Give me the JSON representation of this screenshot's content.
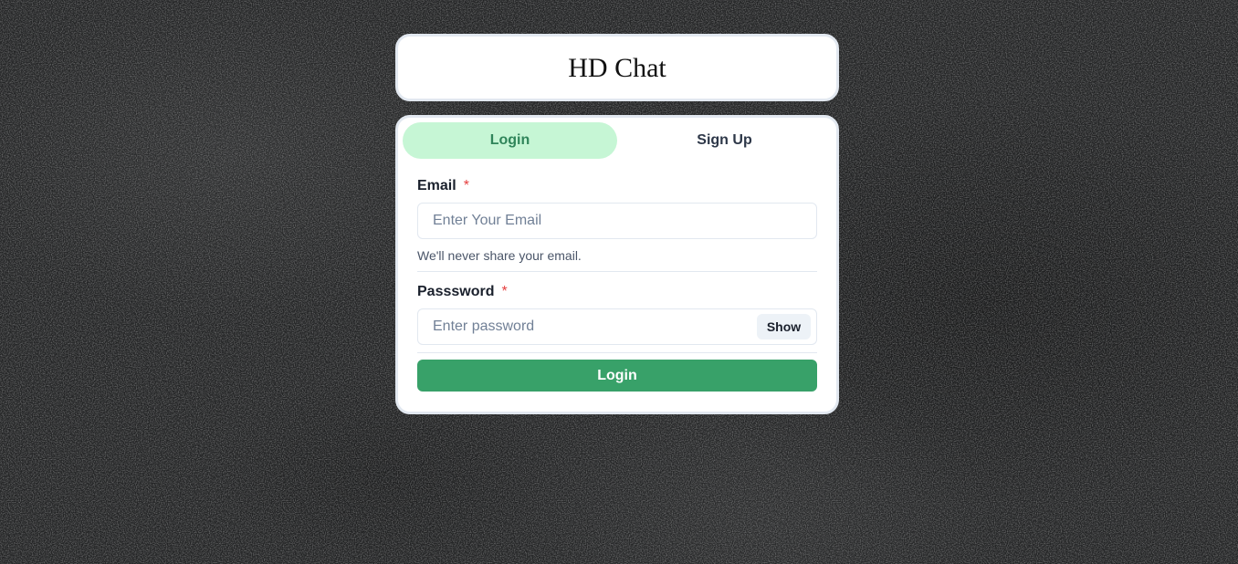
{
  "app": {
    "title": "HD Chat"
  },
  "tabs": [
    {
      "label": "Login",
      "active": true
    },
    {
      "label": "Sign Up",
      "active": false
    }
  ],
  "form": {
    "email": {
      "label": "Email",
      "required_mark": "*",
      "placeholder": "Enter Your Email",
      "value": "",
      "helper": "We'll never share your email."
    },
    "password": {
      "label": "Passsword",
      "required_mark": "*",
      "placeholder": "Enter password",
      "value": "",
      "toggle_label": "Show"
    },
    "submit_label": "Login"
  },
  "colors": {
    "active_tab_bg": "#c6f6d5",
    "active_tab_text": "#2f855a",
    "primary_button": "#38a169",
    "required_mark": "#e53e3e",
    "background": "#232425"
  }
}
